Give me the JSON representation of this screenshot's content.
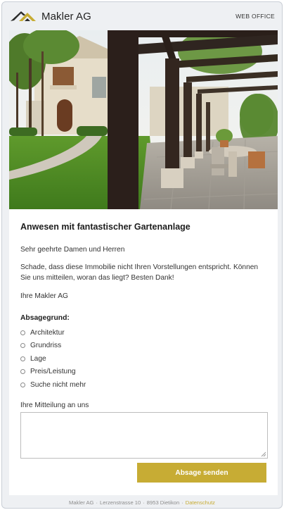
{
  "header": {
    "brand_name": "Makler AG",
    "web_office": "WEB OFFICE"
  },
  "property": {
    "title": "Anwesen mit fantastischer Gartenanlage",
    "image_alt": "Villa mit Pergola und Gartenanlage"
  },
  "message": {
    "greeting": "Sehr geehrte Damen und Herren",
    "body": "Schade, dass diese Immobilie nicht Ihren Vorstellungen entspricht. Können Sie uns mitteilen, woran das liegt? Besten Dank!",
    "signature": "Ihre Makler AG"
  },
  "reasons": {
    "heading": "Absagegrund:",
    "options": [
      "Architektur",
      "Grundriss",
      "Lage",
      "Preis/Leistung",
      "Suche nicht mehr"
    ]
  },
  "comment": {
    "label": "Ihre Mitteilung an uns",
    "value": ""
  },
  "submit_label": "Absage senden",
  "footer": {
    "company": "Makler AG",
    "street": "Lerzenstrasse 10",
    "city": "8953 Dietikon",
    "privacy_link": "Datenschutz"
  },
  "colors": {
    "accent": "#c7ac34",
    "page_background": "#eef0f3"
  },
  "icons": {
    "logo": "house-roof-logo",
    "radio": "radio-unchecked-icon"
  }
}
